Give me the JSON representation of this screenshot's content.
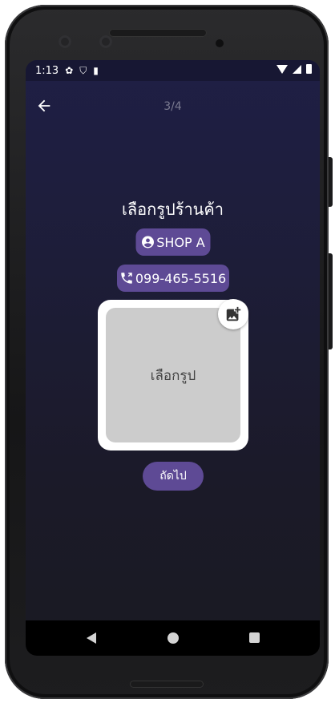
{
  "status_bar": {
    "time": "1:13"
  },
  "header": {
    "step_indicator": "3/4"
  },
  "main": {
    "title": "เลือกรูปร้านค้า",
    "shop_name": "SHOP A",
    "phone_number": "099-465-5516",
    "photo_placeholder": "เลือกรูป",
    "next_label": "ถัดไป"
  },
  "colors": {
    "accent_pill": "#5e4a95",
    "background_top": "#1f1f45",
    "background_bottom": "#1a1a22"
  },
  "icons": {
    "back": "arrow-left-icon",
    "shop": "account-circle-icon",
    "phone": "phone-icon",
    "add_photo": "add-photo-icon"
  }
}
